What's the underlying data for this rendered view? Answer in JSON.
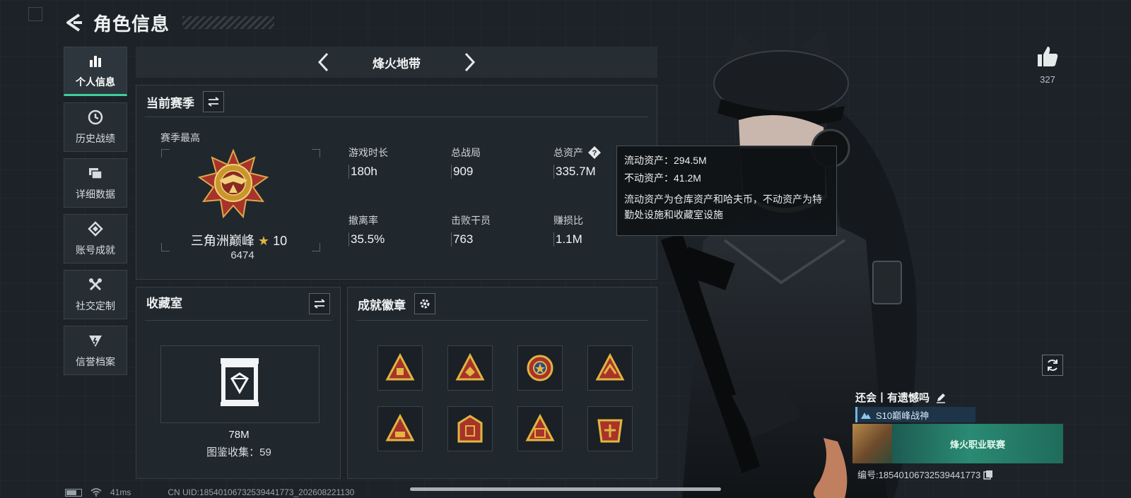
{
  "header": {
    "title": "角色信息"
  },
  "sidebar": {
    "items": [
      {
        "label": "个人信息",
        "icon": "bar-chart-icon",
        "active": true
      },
      {
        "label": "历史战绩",
        "icon": "history-icon"
      },
      {
        "label": "详细数据",
        "icon": "folder-icon"
      },
      {
        "label": "账号成就",
        "icon": "achievement-icon"
      },
      {
        "label": "社交定制",
        "icon": "tools-icon"
      },
      {
        "label": "信誉档案",
        "icon": "reputation-icon"
      }
    ]
  },
  "mode_bar": {
    "title": "烽火地带"
  },
  "season": {
    "title": "当前赛季",
    "best_label": "赛季最高",
    "rank_name": "三角洲巅峰",
    "rank_star": "★",
    "rank_level": "10",
    "rank_points": "6474",
    "stats": [
      {
        "label": "游戏时长",
        "value": "180h"
      },
      {
        "label": "总战局",
        "value": "909"
      },
      {
        "label": "总资产",
        "value": "335.7M"
      },
      {
        "label": "撤离率",
        "value": "35.5%"
      },
      {
        "label": "击败干员",
        "value": "763"
      },
      {
        "label": "赚损比",
        "value": "1.1M"
      }
    ]
  },
  "tooltip": {
    "liquid": "流动资产：294.5M",
    "fixed": "不动资产：41.2M",
    "desc": "流动资产为仓库资产和哈夫币，不动资产为特勤处设施和收藏室设施"
  },
  "collection": {
    "title": "收藏室",
    "amount": "78M",
    "count_label": "图鉴收集：59"
  },
  "badges": {
    "title": "成就徽章"
  },
  "profile": {
    "like_count": "327",
    "player_name": "还会丨有遗憾吗",
    "season_title": "S10巅峰战神",
    "banner_text": "烽火职业联赛",
    "id_line": "编号:18540106732539441773"
  },
  "statusbar": {
    "ping": "41ms",
    "uid": "CN UID:18540106732539441773_202608221130"
  },
  "colors": {
    "accent": "#3ecf9a",
    "gold": "#c9962e",
    "panel": "#20272d"
  }
}
